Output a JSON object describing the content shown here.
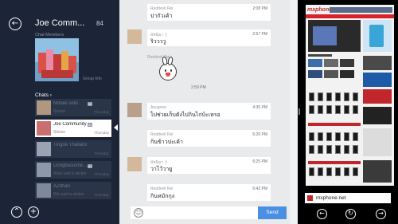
{
  "colors": {
    "sidebar_bg": "#1c2538",
    "chat_bg": "#e9eaec",
    "send_button": "#4a90e2",
    "browser_bg": "#000000",
    "site_brand": "#c0262c"
  },
  "sidebar": {
    "back_icon": "back-arrow-icon",
    "title": "Joe Comm...",
    "member_count": "84",
    "members_label": "Chat Members",
    "group_info_label": "Group Info",
    "chats_label": "Chats ›",
    "chats": [
      {
        "name": "Mobile sells",
        "count": "92",
        "preview": "Sticker",
        "date": "Thursday"
      },
      {
        "name": "Joe Community",
        "count": "84",
        "preview": "Sticker",
        "date": "Thursday"
      },
      {
        "name": "Tingoe Thailand",
        "count": "",
        "preview": "",
        "date": "Thursday"
      },
      {
        "name": "Dongbasiome...",
        "count": "62",
        "preview": "Atlas said a sticker",
        "date": "Thursday"
      },
      {
        "name": "AZIthan",
        "count": "",
        "preview": "Wiz said a sticker",
        "date": "Thursday"
      }
    ],
    "up_icon": "chevron-up-icon",
    "add_icon": "plus-icon"
  },
  "chat": {
    "messages": [
      {
        "sender": "Reddevil Rei",
        "text": "ปากัวเค้า",
        "time": "2:08 PM"
      },
      {
        "sender": "มัชฉิมา :)",
        "text": "ริววววู",
        "time": "2:57 PM"
      },
      {
        "sender": "Anugone",
        "text": "ไปช่วยเก็บตังไปกินไก่บ้ะเหรอ",
        "time": "4:35 PM"
      },
      {
        "sender": "Reddevil Rei",
        "text": "กินข้าวปะเค้า",
        "time": "6:20 PM"
      },
      {
        "sender": "มัชฉิมา :)",
        "text": "วาไว้วายู",
        "time": "6:25 PM"
      },
      {
        "sender": "Reddevil Rei",
        "text": "กินหมักกุง",
        "time": "6:42 PM"
      }
    ],
    "sticker": {
      "sender": "Reddevil Rei",
      "time": "2:59 PM",
      "icon": "bunny-sticker-icon"
    },
    "compose": {
      "emoji_icon": "smiley-icon",
      "send_label": "Send"
    }
  },
  "browser": {
    "site_logo": "mxphone",
    "address": "mxphone.net",
    "back_icon": "back-arrow-icon",
    "refresh_icon": "refresh-icon",
    "forward_icon": "forward-arrow-icon"
  }
}
